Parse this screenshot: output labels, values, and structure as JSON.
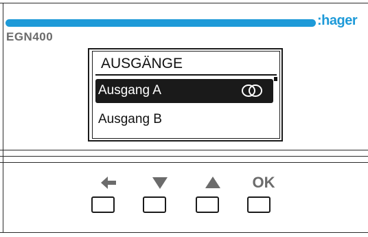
{
  "device": {
    "brand": ":hager",
    "model": "EGN400",
    "accent_color": "#1e9ad8"
  },
  "display": {
    "title": "AUSGÄNGE",
    "items": [
      {
        "label": "Ausgang A",
        "selected": true,
        "icon": "interlinked-rings-icon"
      },
      {
        "label": "Ausgang B",
        "selected": false
      }
    ]
  },
  "buttons": [
    {
      "name": "back",
      "icon": "arrow-left-icon"
    },
    {
      "name": "down",
      "icon": "triangle-down-icon"
    },
    {
      "name": "up",
      "icon": "triangle-up-icon"
    },
    {
      "name": "ok",
      "label": "OK"
    }
  ]
}
